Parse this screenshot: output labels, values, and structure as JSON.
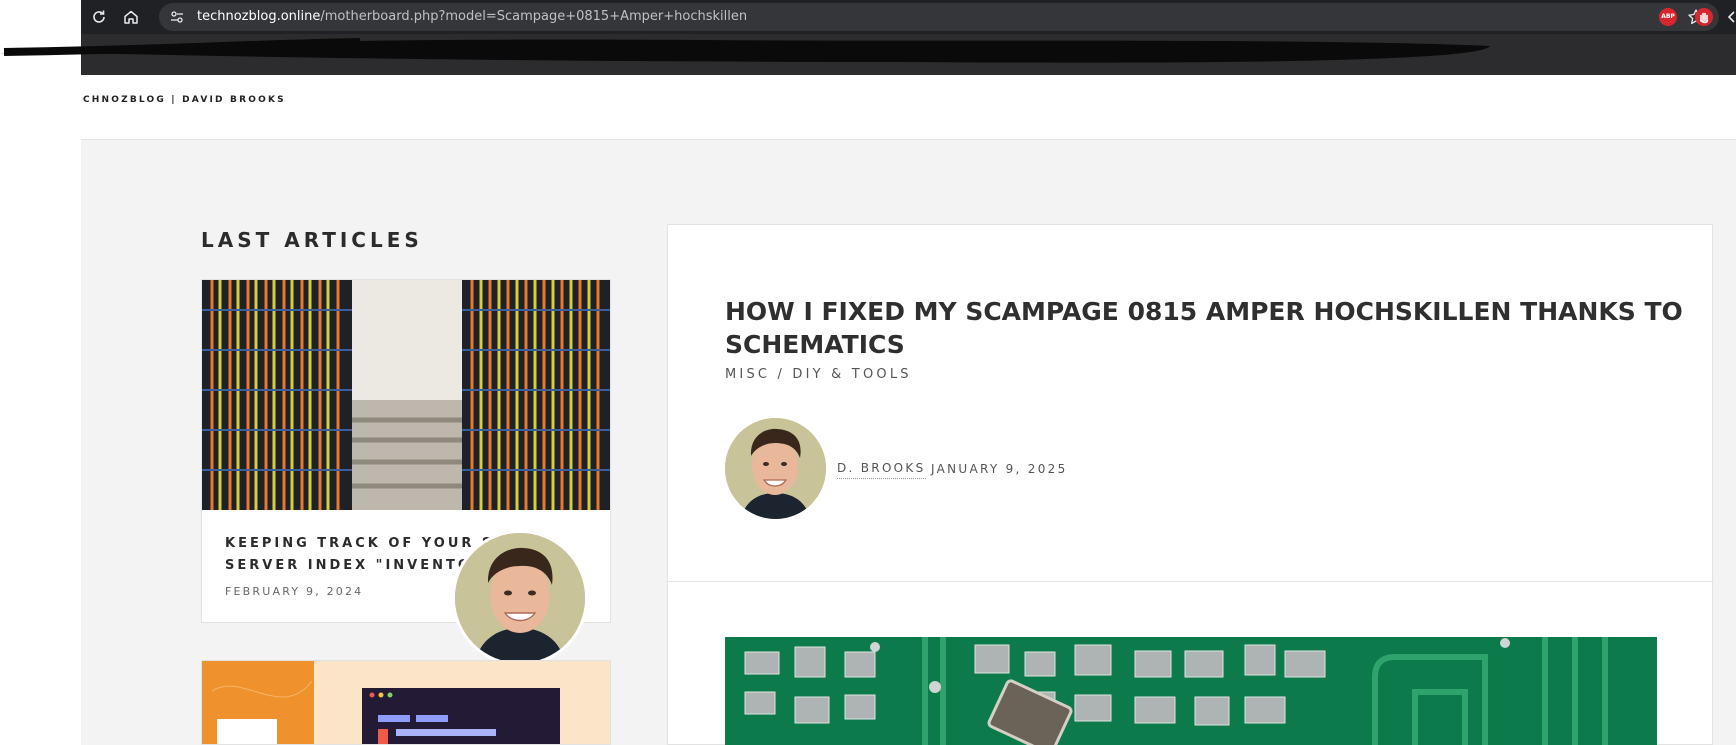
{
  "browser": {
    "url_host": "technozblog.online",
    "url_path": "/motherboard.php?model=Scampage+0815+Amper+hochskillen",
    "extension_abp_label": "ABP"
  },
  "site": {
    "brand": "CHNOZBLOG | DAVID BROOKS"
  },
  "sidebar": {
    "heading": "LAST ARTICLES",
    "articles": [
      {
        "title_line_1": "KEEPING TRACK OF YOUR SO",
        "title_line_2": "SERVER INDEX \"INVENTOR",
        "date": "FEBRUARY 9, 2024"
      }
    ]
  },
  "article": {
    "title": "HOW I FIXED MY SCAMPAGE 0815 AMPER HOCHSKILLEN THANKS TO SCHEMATICS",
    "category": "MISC / DIY & TOOLS",
    "author": "D. BROOKS",
    "date": "JANUARY 9, 2025"
  },
  "colors": {
    "browser_chrome": "#202124",
    "omnibox": "#35363a",
    "page_background": "#f3f3f3",
    "card_background": "#ffffff",
    "pcb_green": "#0c7a4a",
    "avatar_background": "#c9c39a"
  }
}
